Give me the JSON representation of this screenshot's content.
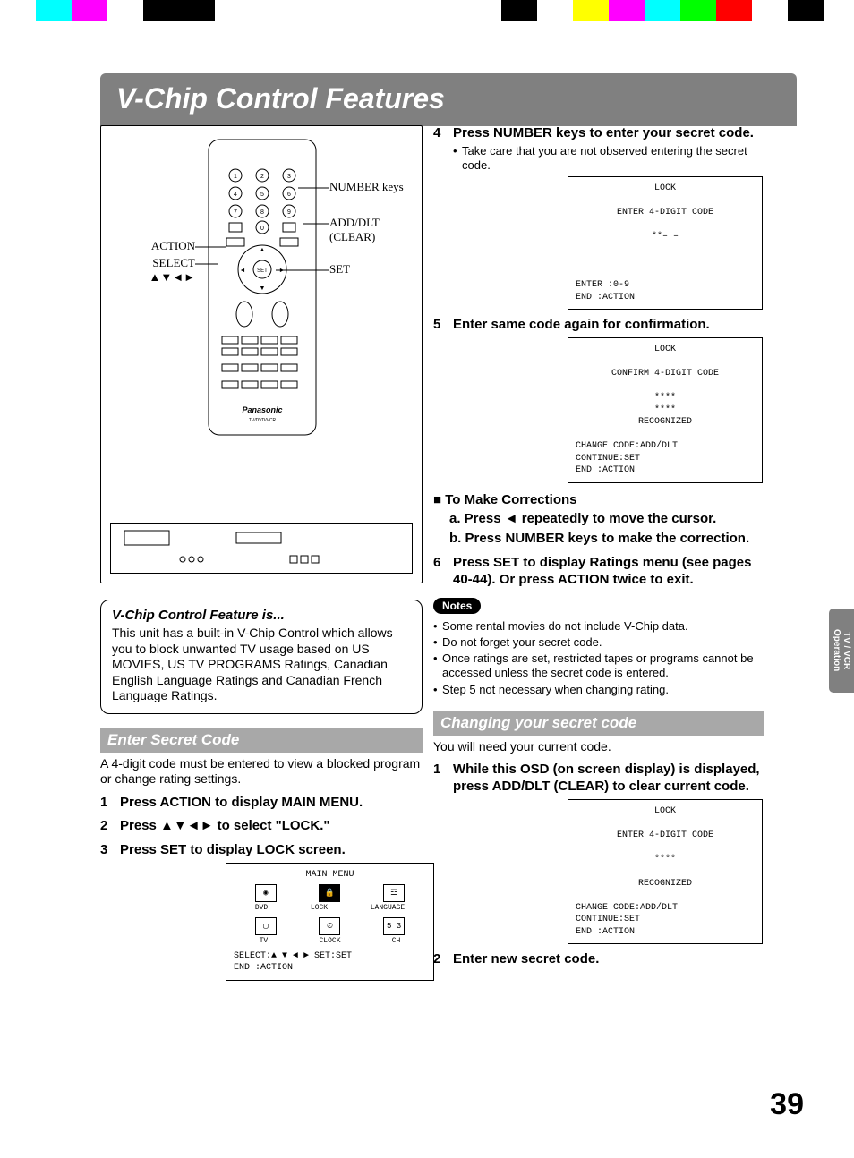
{
  "page_number": "39",
  "side_tab": "TV / VCR Operation",
  "title": "V-Chip Control Features",
  "remote_labels": {
    "action": "ACTION",
    "select": "SELECT",
    "select_arrows": "▲▼◄►",
    "number": "NUMBER keys",
    "add_dlt": "ADD/DLT (CLEAR)",
    "set": "SET",
    "brand": "Panasonic",
    "model": "TV/DVD/VCR"
  },
  "feature_box": {
    "title": "V-Chip Control Feature is...",
    "body": "This unit has a built-in V-Chip Control which allows you to block unwanted TV usage based on US MOVIES, US TV PROGRAMS Ratings, Canadian English Language Ratings and Canadian French Language Ratings."
  },
  "enter_secret": {
    "heading": "Enter Secret Code",
    "intro": "A 4-digit code must be entered to view a blocked program or change rating settings.",
    "s1": "Press ACTION to display MAIN MENU.",
    "s2": "Press ▲▼◄► to select \"LOCK.\"",
    "s3": "Press SET to display LOCK screen."
  },
  "osd_main": {
    "title": "MAIN MENU",
    "i1": "DVD",
    "i2": "LOCK",
    "i3": "LANGUAGE",
    "i4": "TV",
    "i5": "CLOCK",
    "i6": "CH",
    "foot1": "SELECT:▲ ▼ ◄ ►   SET:SET",
    "foot2": "END   :ACTION"
  },
  "right": {
    "s4": "Press NUMBER keys to enter your secret code.",
    "s4_sub": "Take care that you are not observed entering the secret code.",
    "s5": "Enter same code again for confirmation.",
    "corr_head": "■ To Make Corrections",
    "corr_a": "a. Press ◄ repeatedly to move the cursor.",
    "corr_b": "b. Press NUMBER keys to make the correction.",
    "s6": "Press SET to display Ratings menu (see pages 40-44). Or press ACTION twice to exit."
  },
  "osd_lock1": {
    "title": "LOCK",
    "l1": "ENTER 4-DIGIT CODE",
    "l2": "**– –",
    "foot1": "ENTER :0-9",
    "foot2": "END   :ACTION"
  },
  "osd_lock2": {
    "title": "LOCK",
    "l1": "CONFIRM 4-DIGIT CODE",
    "l2": "****",
    "l3": "****",
    "l4": "RECOGNIZED",
    "foot1": "CHANGE CODE:ADD/DLT",
    "foot2": "CONTINUE:SET",
    "foot3": "END    :ACTION"
  },
  "notes": {
    "label": "Notes",
    "n1": "Some rental movies do not include V-Chip data.",
    "n2": "Do not forget your secret code.",
    "n3": "Once ratings are set, restricted tapes or programs cannot be accessed unless the secret code is entered.",
    "n4": "Step 5 not necessary when changing rating."
  },
  "changing": {
    "heading": "Changing your secret code",
    "intro": "You will need your current code.",
    "s1": "While this OSD (on screen display) is displayed, press ADD/DLT (CLEAR) to clear current code.",
    "s2": "Enter new secret code."
  },
  "osd_lock3": {
    "title": "LOCK",
    "l1": "ENTER 4-DIGIT CODE",
    "l2": "****",
    "l3": "RECOGNIZED",
    "foot1": "CHANGE CODE:ADD/DLT",
    "foot2": "CONTINUE:SET",
    "foot3": "END    :ACTION"
  }
}
